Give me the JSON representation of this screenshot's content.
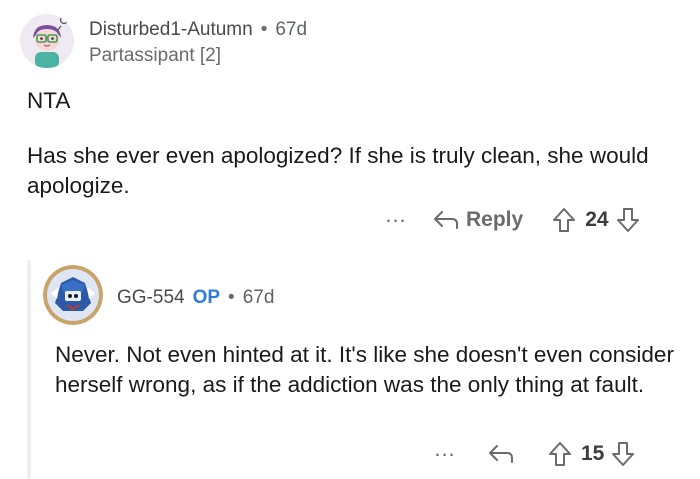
{
  "comments": [
    {
      "username": "Disturbed1-Autumn",
      "separator": "•",
      "age": "67d",
      "flair": "Partassipant [2]",
      "body": [
        "NTA",
        "Has she ever even apologized?  If she is truly clean, she would apologize."
      ],
      "more_label": "...",
      "reply_label": "Reply",
      "score": "24"
    },
    {
      "username": "GG-554",
      "op_badge": "OP",
      "separator": "•",
      "age": "67d",
      "body": [
        "Never. Not even hinted at it. It's like she doesn't even consider herself wrong, as if the addiction was the only thing at fault."
      ],
      "more_label": "...",
      "score": "15"
    }
  ],
  "colors": {
    "op_badge": "#2f7bd8",
    "avatar1_bg": "#e7e0ec",
    "avatar1_hair": "#7e4f9c",
    "avatar1_shirt": "#4bb3a4",
    "avatar2_ring": "#c9a46a",
    "avatar2_bg": "#dfe6f3",
    "avatar2_armor": "#2c5aa8"
  }
}
